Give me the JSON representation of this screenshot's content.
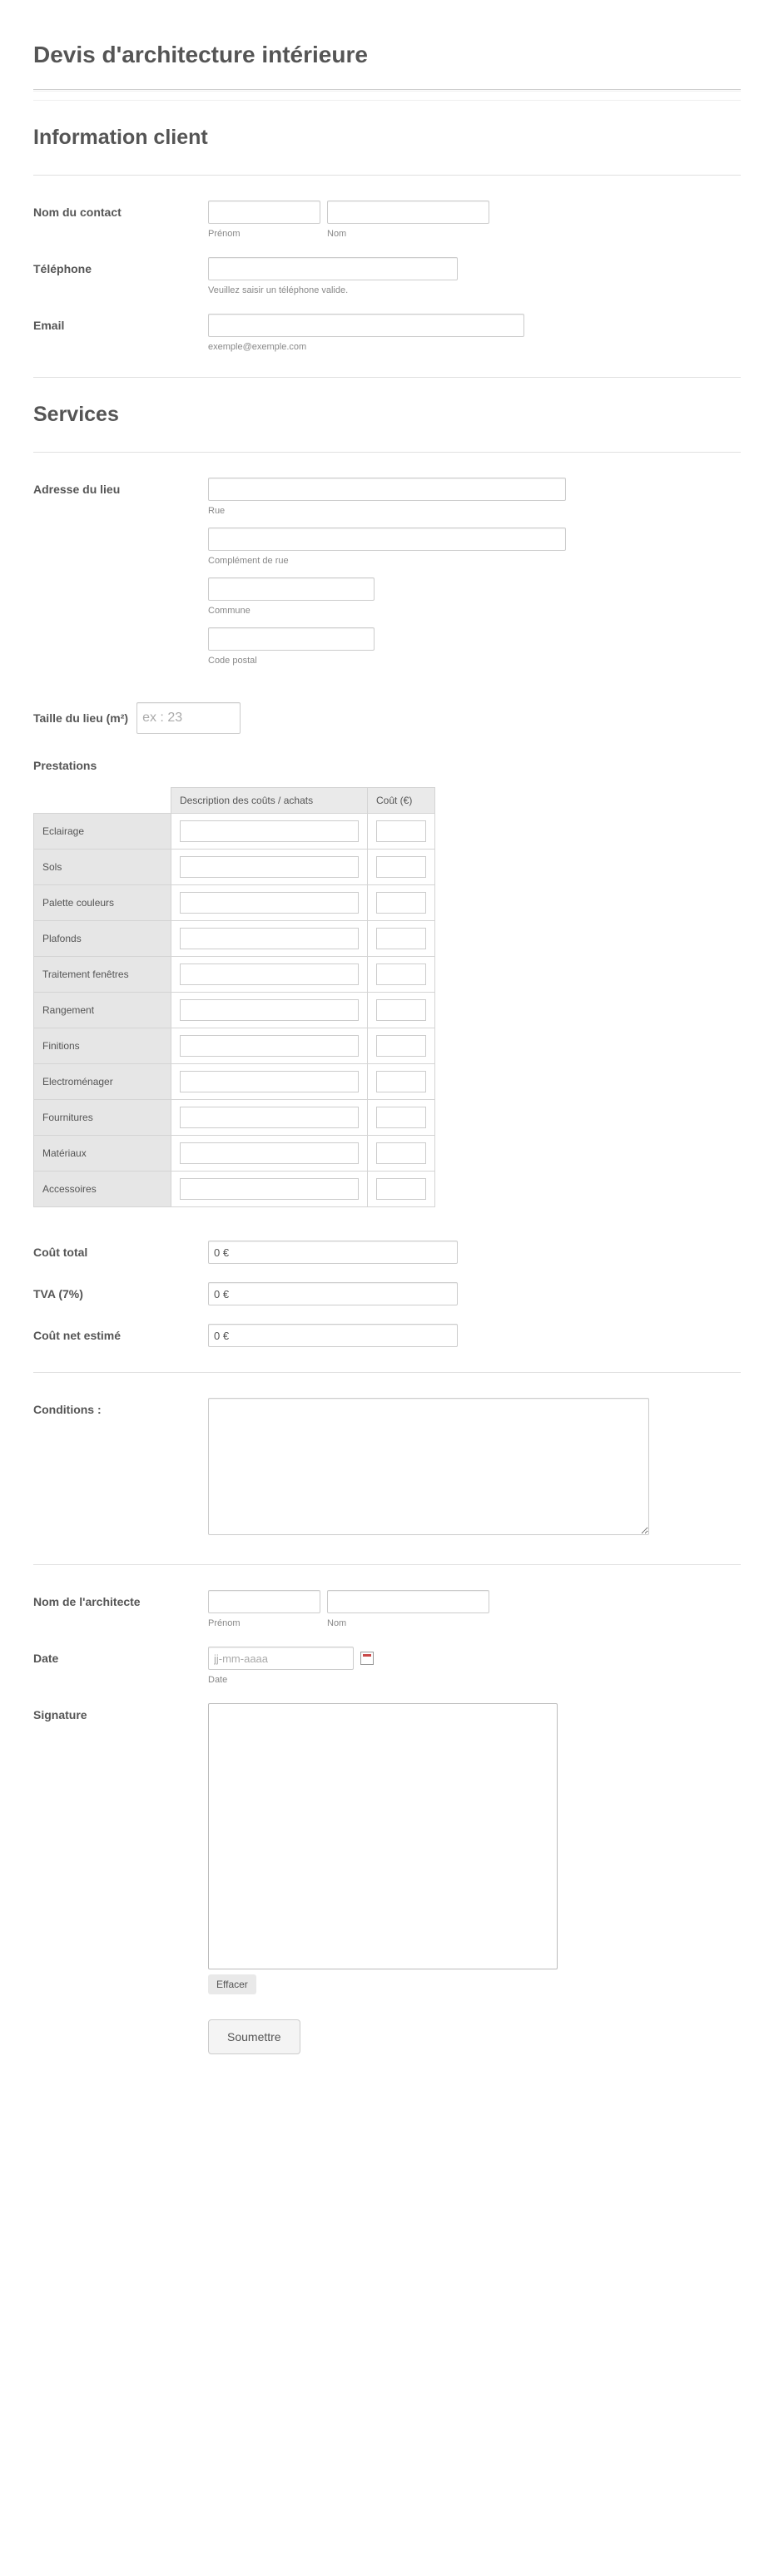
{
  "titles": {
    "main": "Devis d'architecture intérieure",
    "client": "Information client",
    "services": "Services"
  },
  "fields": {
    "contact_name": {
      "label": "Nom du contact",
      "first_hint": "Prénom",
      "last_hint": "Nom"
    },
    "telephone": {
      "label": "Téléphone",
      "hint": "Veuillez saisir un téléphone valide."
    },
    "email": {
      "label": "Email",
      "hint": "exemple@exemple.com"
    },
    "address": {
      "label": "Adresse du lieu",
      "street_hint": "Rue",
      "street2_hint": "Complément de rue",
      "city_hint": "Commune",
      "postal_hint": "Code postal"
    },
    "size": {
      "label": "Taille du lieu (m²)",
      "placeholder": "ex : 23"
    },
    "prestations_header": "Prestations",
    "total": {
      "label": "Coût total",
      "value": "0 €"
    },
    "tva": {
      "label": "TVA (7%)",
      "value": "0 €"
    },
    "net": {
      "label": "Coût net estimé",
      "value": "0 €"
    },
    "conditions": {
      "label": "Conditions :"
    },
    "architect_name": {
      "label": "Nom de l'architecte",
      "first_hint": "Prénom",
      "last_hint": "Nom"
    },
    "date": {
      "label": "Date",
      "placeholder": "jj-mm-aaaa",
      "hint": "Date"
    },
    "signature": {
      "label": "Signature",
      "clear": "Effacer"
    },
    "submit": "Soumettre"
  },
  "prestations": {
    "col_desc": "Description des coûts / achats",
    "col_cost": "Coût (€)",
    "rows": [
      "Eclairage",
      "Sols",
      "Palette couleurs",
      "Plafonds",
      "Traitement fenêtres",
      "Rangement",
      "Finitions",
      "Electroménager",
      "Fournitures",
      "Matériaux",
      "Accessoires"
    ]
  }
}
